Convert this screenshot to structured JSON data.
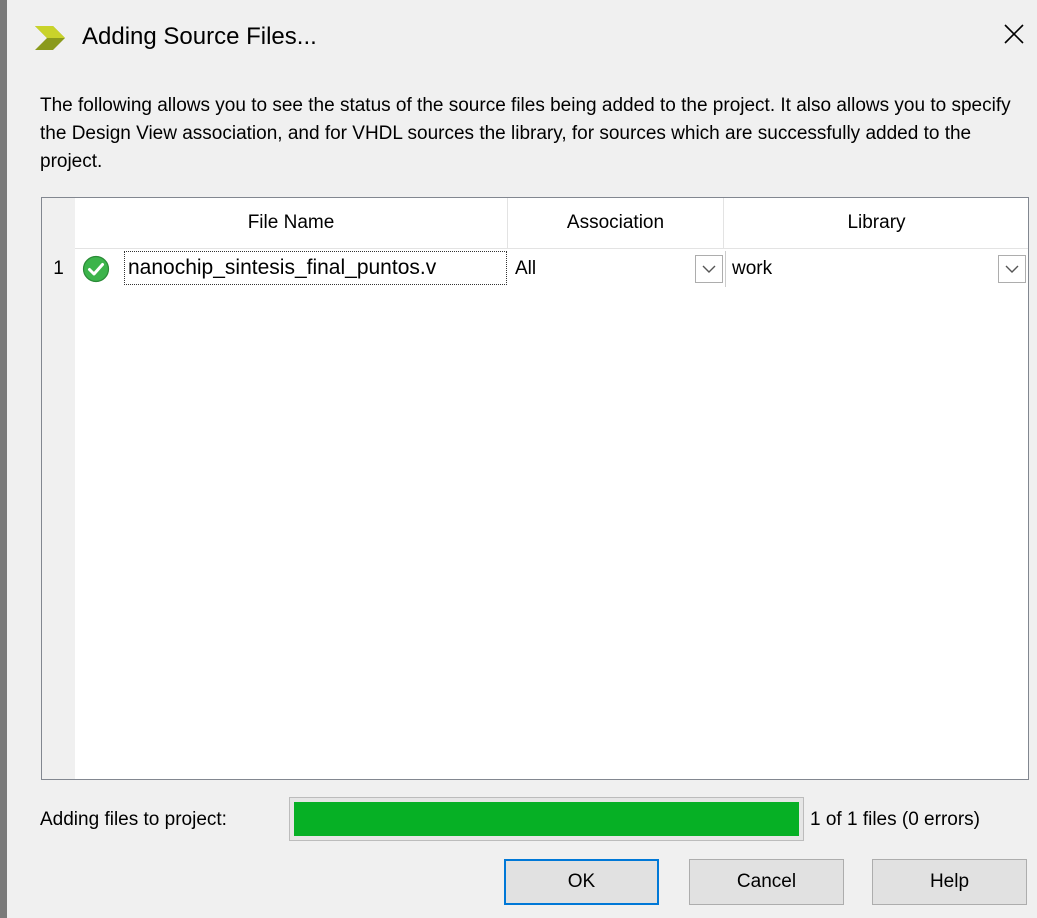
{
  "window": {
    "title": "Adding Source Files...",
    "icon": "xilinx-chevron-icon",
    "close_icon": "close-icon"
  },
  "description": "The following allows you to see the status of the source files being added to the project.  It also allows you to specify the Design View association, and for VHDL sources the library, for sources which are successfully added to the project.",
  "table": {
    "columns": [
      "File Name",
      "Association",
      "Library"
    ],
    "rows": [
      {
        "num": "1",
        "status": "success-check-icon",
        "file": "nanochip_sintesis_final_puntos.v",
        "association": "All",
        "library": "work"
      }
    ]
  },
  "progress": {
    "label": "Adding files to project:",
    "fraction": 1.0,
    "status": "1 of 1 files (0 errors)",
    "color": "#06b025"
  },
  "buttons": {
    "ok": "OK",
    "cancel": "Cancel",
    "help": "Help"
  }
}
